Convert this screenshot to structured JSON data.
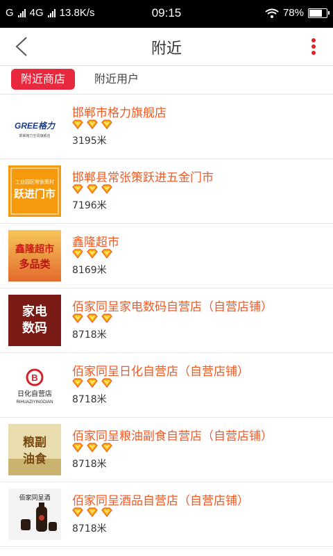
{
  "status": {
    "carrier_sim": "G",
    "network": "4G",
    "speed": "13.8K/s",
    "time": "09:15",
    "battery": "78%",
    "battery_level": 0.78
  },
  "header": {
    "title": "附近"
  },
  "tabs": [
    {
      "label": "附近商店",
      "active": true
    },
    {
      "label": "附近用户",
      "active": false
    }
  ],
  "shops": [
    {
      "name": "邯郸市格力旗舰店",
      "distance": "3195米",
      "rating": 3,
      "thumb": {
        "text": "GREE格力",
        "sub": "邯郸格力空调旗舰店"
      }
    },
    {
      "name": "邯郸县常张策跃进五金门市",
      "distance": "7196米",
      "rating": 3,
      "thumb": {
        "text": "跃进门市",
        "sub": "工业园区常张策村"
      }
    },
    {
      "name": "鑫隆超市",
      "distance": "8169米",
      "rating": 3,
      "thumb": {
        "text": "鑫隆超市",
        "sub": "多品类"
      }
    },
    {
      "name": "佰家同呈家电数码自营店（自营店铺）",
      "distance": "8718米",
      "rating": 3,
      "thumb": {
        "text": "家电",
        "sub": "数码"
      }
    },
    {
      "name": "佰家同呈日化自营店（自营店铺）",
      "distance": "8718米",
      "rating": 3,
      "thumb": {
        "text": "日化自营店",
        "sub": "RIHUAZIYINGDIAN"
      }
    },
    {
      "name": "佰家同呈粮油副食自营店（自营店铺）",
      "distance": "8718米",
      "rating": 3,
      "thumb": {
        "text": "粮副",
        "sub": "油食"
      }
    },
    {
      "name": "佰家同呈酒品自营店（自营店铺）",
      "distance": "8718米",
      "rating": 3,
      "thumb": {
        "text": "佰家同呈酒",
        "sub": ""
      }
    }
  ],
  "colors": {
    "accent": "#e8283d",
    "shop_name": "#f05a23",
    "rating_fill": "#f7b500",
    "rating_stroke": "#f05a23"
  },
  "icons": {
    "back": "chevron-left-icon",
    "more": "more-vertical-icon",
    "rating": "diamond-heart-icon"
  }
}
